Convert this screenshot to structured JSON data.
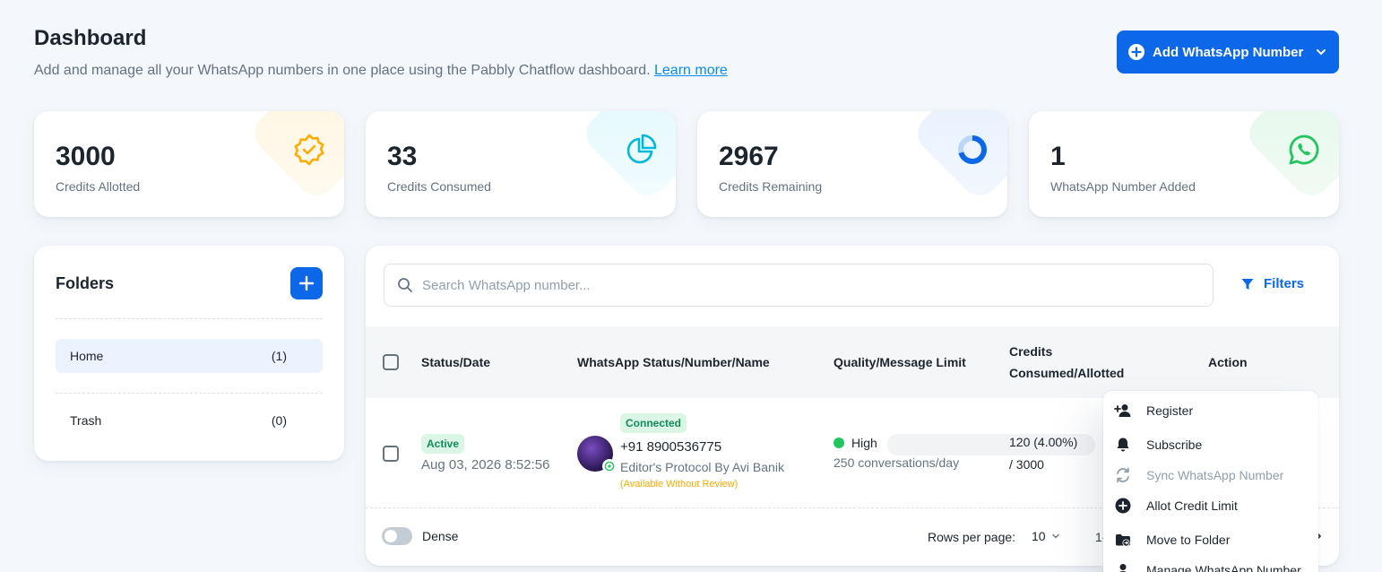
{
  "header": {
    "title": "Dashboard",
    "subtitle": "Add and manage all your WhatsApp numbers in one place using the Pabbly Chatflow dashboard.",
    "learn_more": "Learn more",
    "add_button": "Add WhatsApp Number"
  },
  "stats": [
    {
      "value": "3000",
      "label": "Credits Allotted",
      "icon": "badge-check-icon",
      "color": "#ffab00"
    },
    {
      "value": "33",
      "label": "Credits Consumed",
      "icon": "pie-chart-icon",
      "color": "#00b8d9"
    },
    {
      "value": "2967",
      "label": "Credits Remaining",
      "icon": "donut-chart-icon",
      "color": "#0c68e9"
    },
    {
      "value": "1",
      "label": "WhatsApp Number Added",
      "icon": "whatsapp-icon",
      "color": "#22c55e"
    }
  ],
  "folders": {
    "title": "Folders",
    "items": [
      {
        "name": "Home",
        "count": "(1)"
      },
      {
        "name": "Trash",
        "count": "(0)"
      }
    ]
  },
  "table": {
    "search_placeholder": "Search WhatsApp number...",
    "filters_label": "Filters",
    "columns": {
      "status_date": "Status/Date",
      "wa_status": "WhatsApp Status/Number/Name",
      "quality": "Quality/Message Limit",
      "credits_line1": "Credits",
      "credits_line2": "Consumed/Allotted",
      "action": "Action"
    },
    "rows": [
      {
        "status": "Active",
        "date": "Aug 03, 2026 8:52:56",
        "wa_status": "Connected",
        "number": "+91 8900536775",
        "name": "Editor's Protocol By Avi Banik",
        "review": "(Available Without Review)",
        "quality": "High",
        "limit": "250 conversations/day",
        "credits_consumed": "120 (4.00%)",
        "credits_allotted": "/ 3000"
      }
    ],
    "footer": {
      "dense_label": "Dense",
      "rows_per_page_label": "Rows per page:",
      "rows_per_page_value": "10",
      "pagination_partial": "1-"
    }
  },
  "action_menu": {
    "items": [
      {
        "label": "Register",
        "icon": "person-add-icon",
        "disabled": false
      },
      {
        "label": "Subscribe",
        "icon": "bell-icon",
        "disabled": false
      },
      {
        "label": "Sync WhatsApp Number",
        "icon": "sync-icon",
        "disabled": true
      },
      {
        "label": "Allot Credit Limit",
        "icon": "plus-circle-icon",
        "disabled": false
      },
      {
        "label": "Move to Folder",
        "icon": "folder-move-icon",
        "disabled": false
      },
      {
        "label": "Manage WhatsApp Number",
        "icon": "person-icon",
        "disabled": false
      }
    ]
  }
}
